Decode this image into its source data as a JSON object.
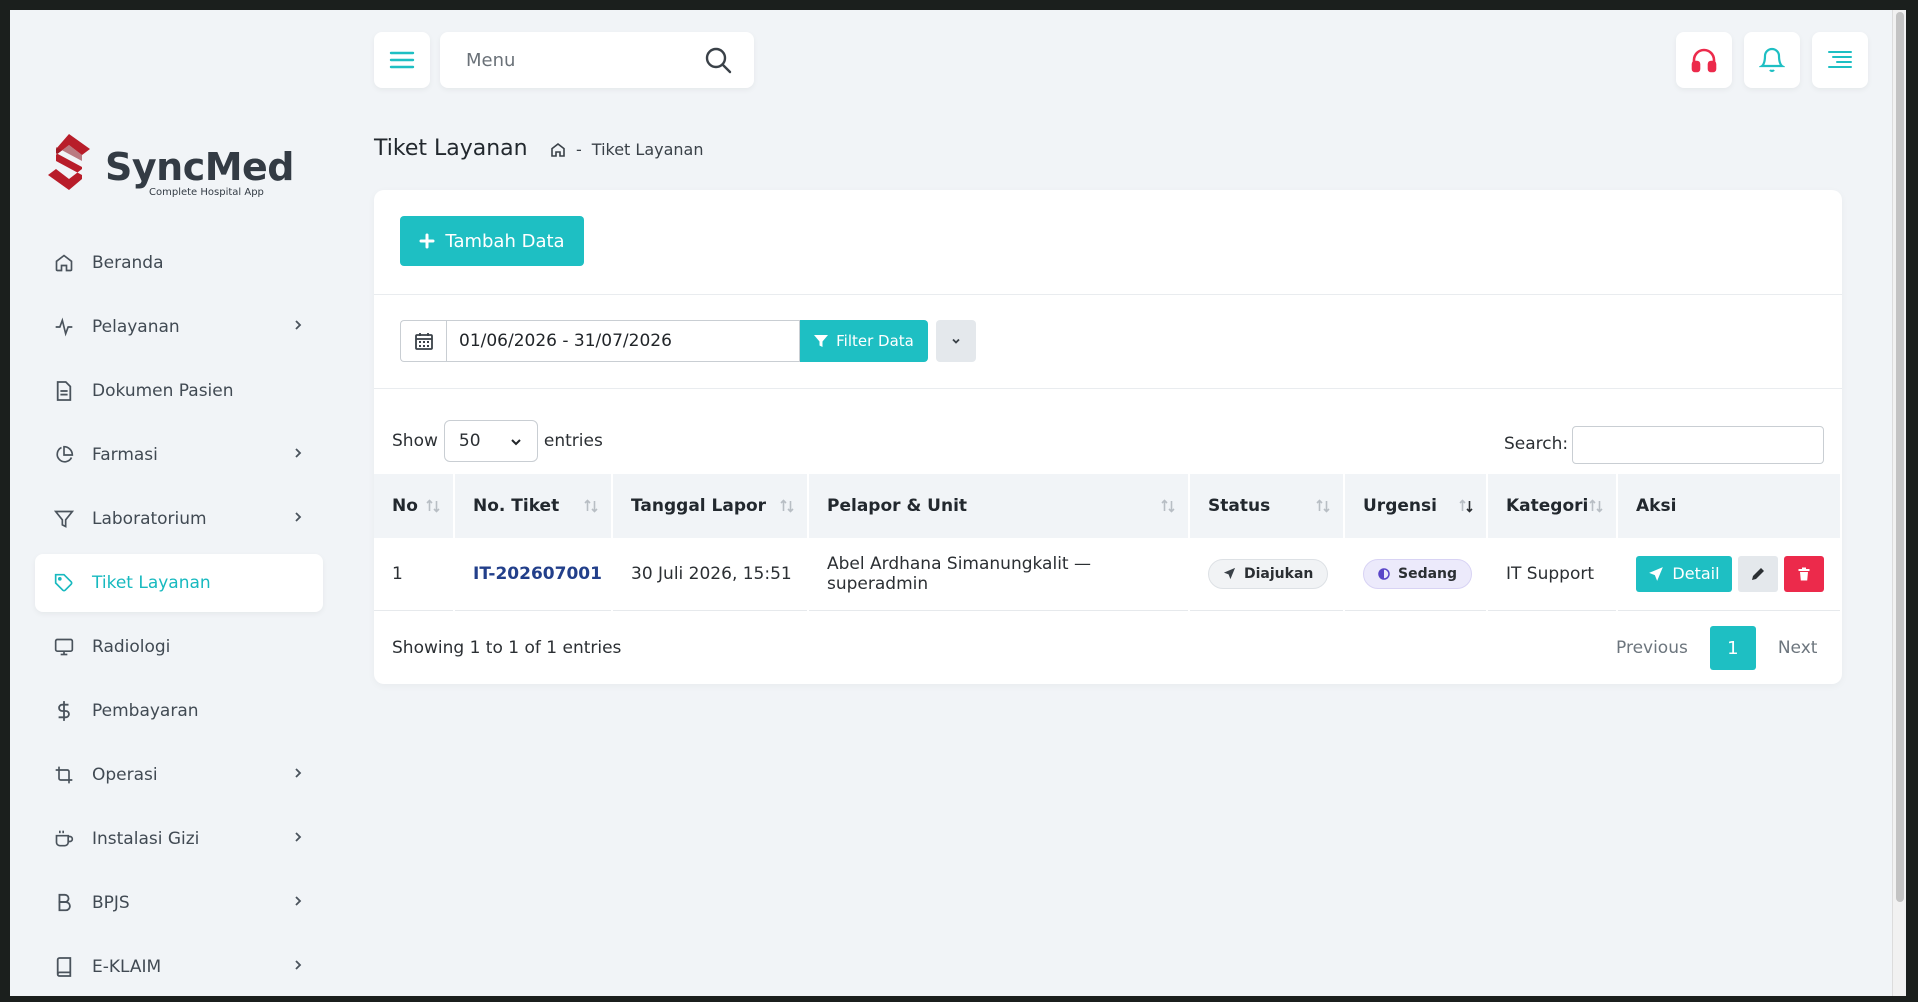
{
  "brand": {
    "name": "SyncMed",
    "tagline": "Complete Hospital App",
    "colors": {
      "primary": "#1ebfc3",
      "logo_red": "#b81d2a",
      "danger": "#ec2a4b",
      "link": "#223f8a"
    }
  },
  "topbar": {
    "search_placeholder": "Menu",
    "icons": [
      "hamburger-icon",
      "search-icon",
      "headset-icon",
      "bell-icon",
      "menu-lines-icon"
    ]
  },
  "sidebar": {
    "items": [
      {
        "label": "Beranda",
        "icon": "home-icon",
        "has_submenu": false,
        "active": false
      },
      {
        "label": "Pelayanan",
        "icon": "pulse-icon",
        "has_submenu": true,
        "active": false
      },
      {
        "label": "Dokumen Pasien",
        "icon": "document-icon",
        "has_submenu": false,
        "active": false
      },
      {
        "label": "Farmasi",
        "icon": "pie-chart-icon",
        "has_submenu": true,
        "active": false
      },
      {
        "label": "Laboratorium",
        "icon": "filter-icon",
        "has_submenu": true,
        "active": false
      },
      {
        "label": "Tiket Layanan",
        "icon": "tag-icon",
        "has_submenu": false,
        "active": true
      },
      {
        "label": "Radiologi",
        "icon": "monitor-icon",
        "has_submenu": false,
        "active": false
      },
      {
        "label": "Pembayaran",
        "icon": "dollar-icon",
        "has_submenu": false,
        "active": false
      },
      {
        "label": "Operasi",
        "icon": "crop-icon",
        "has_submenu": true,
        "active": false
      },
      {
        "label": "Instalasi Gizi",
        "icon": "cup-icon",
        "has_submenu": true,
        "active": false
      },
      {
        "label": "BPJS",
        "icon": "bold-b-icon",
        "has_submenu": true,
        "active": false
      },
      {
        "label": "E-KLAIM",
        "icon": "book-icon",
        "has_submenu": true,
        "active": false
      }
    ]
  },
  "page": {
    "title": "Tiket Layanan",
    "breadcrumb": {
      "separator": "-",
      "current": "Tiket Layanan"
    }
  },
  "toolbar": {
    "add_label": "Tambah Data",
    "date_range": "01/06/2026 - 31/07/2026",
    "filter_label": "Filter Data"
  },
  "table": {
    "show_label": "Show",
    "page_size": "50",
    "entries_label": "entries",
    "search_label": "Search:",
    "search_value": "",
    "columns": [
      "No",
      "No. Tiket",
      "Tanggal Lapor",
      "Pelapor & Unit",
      "Status",
      "Urgensi",
      "Kategori",
      "Aksi"
    ],
    "sorted_column": "Urgensi",
    "rows": [
      {
        "no": "1",
        "ticket": "IT-202607001",
        "date": "30 Juli 2026, 15:51",
        "reporter": "Abel Ardhana Simanungkalit — superadmin",
        "status": "Diajukan",
        "urgency": "Sedang",
        "category": "IT Support",
        "detail_label": "Detail"
      }
    ],
    "info": "Showing 1 to 1 of 1 entries",
    "pagination": {
      "previous": "Previous",
      "current": "1",
      "next": "Next"
    }
  }
}
